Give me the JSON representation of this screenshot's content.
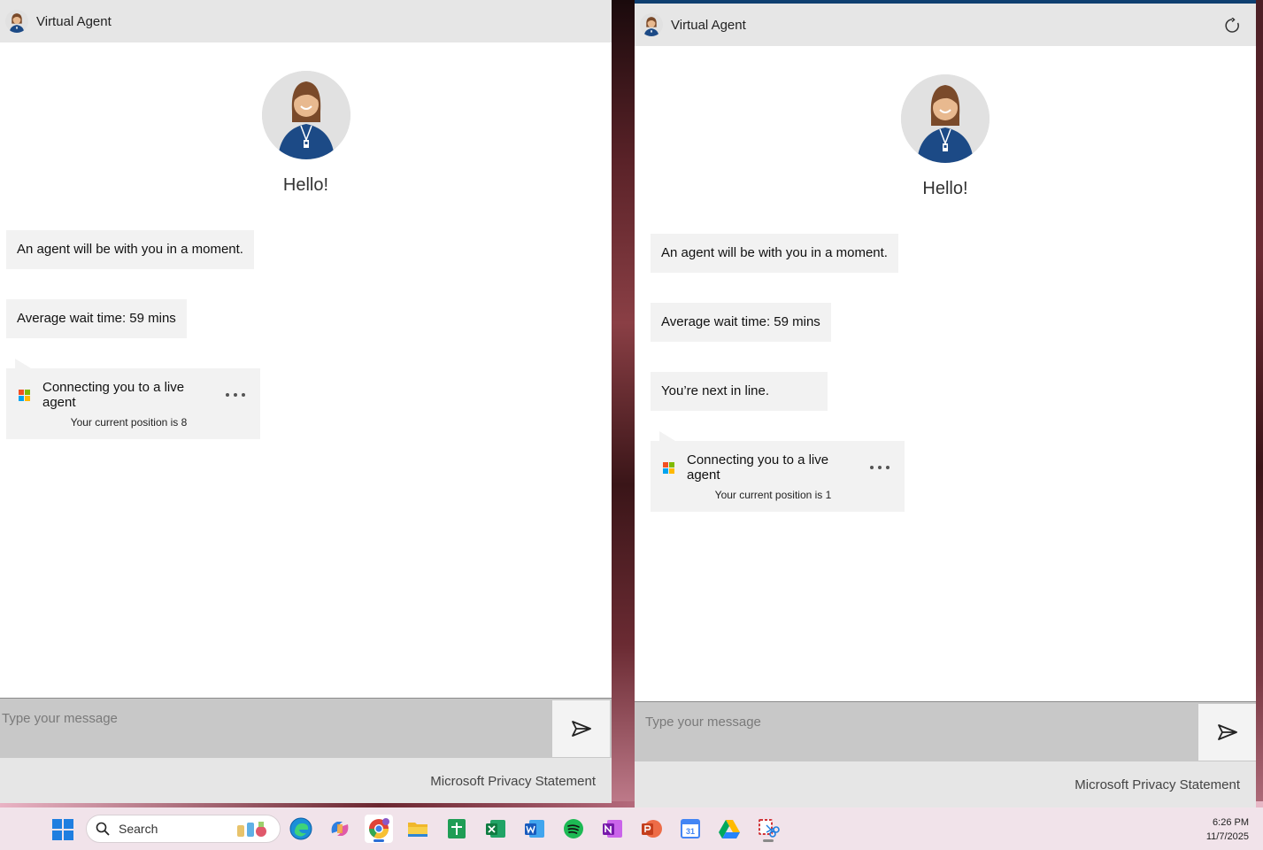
{
  "left_window": {
    "title": "Virtual Agent",
    "greeting": "Hello!",
    "messages": [
      "An agent will be with you in a moment.",
      "Average wait time: 59 mins"
    ],
    "connecting": {
      "text": "Connecting you to a live agent",
      "position": "Your current position is 8"
    },
    "composer_placeholder": "Type your message",
    "privacy_link": "Microsoft Privacy Statement"
  },
  "right_window": {
    "title": "Virtual Agent",
    "greeting": "Hello!",
    "messages": [
      "An agent will be with you in a moment.",
      "Average wait time: 59 mins",
      "You’re next in line."
    ],
    "connecting": {
      "text": "Connecting you to a live agent",
      "position": "Your current position is 1"
    },
    "composer_placeholder": "Type your message",
    "privacy_link": "Microsoft Privacy Statement"
  },
  "taskbar": {
    "search_label": "Search",
    "apps": [
      "start-icon",
      "edge-icon",
      "copilot-icon",
      "chrome-icon",
      "file-explorer-icon",
      "google-sheets-icon",
      "excel-icon",
      "word-icon",
      "spotify-icon",
      "onenote-icon",
      "powerpoint-icon",
      "google-calendar-icon",
      "google-drive-icon",
      "snipping-tool-icon"
    ],
    "calendar_day": "31",
    "time": "6:26 PM",
    "date": "11/7/2025"
  },
  "colors": {
    "titlebar": "#e6e6e6",
    "bubble": "#f2f2f2",
    "composer": "#c8c8c8",
    "accent_border": "#0f3f70"
  }
}
